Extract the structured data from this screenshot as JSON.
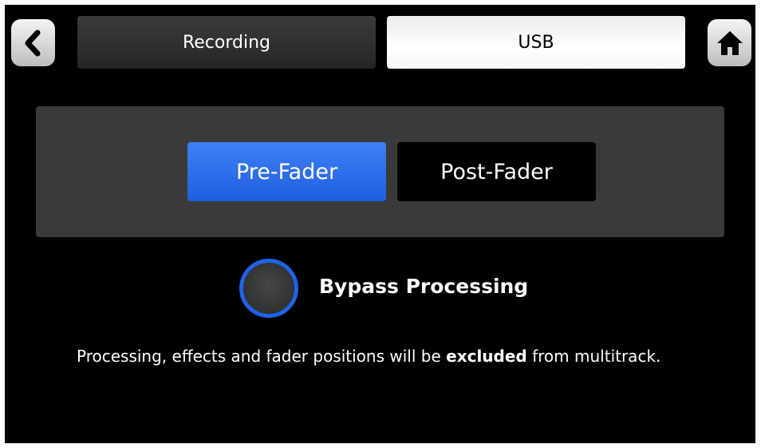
{
  "header": {
    "back_icon": "chevron-left-icon",
    "home_icon": "home-icon",
    "tabs": [
      {
        "label": "Recording",
        "selected": false
      },
      {
        "label": "USB",
        "selected": true
      }
    ]
  },
  "tap_point": {
    "options": [
      "Pre-Fader",
      "Post-Fader"
    ],
    "selected": "Pre-Fader"
  },
  "bypass": {
    "label": "Bypass Processing",
    "enabled": false
  },
  "info": {
    "prefix": "Processing, effects and fader positions will be ",
    "emphasis": "excluded",
    "suffix": " from multitrack."
  },
  "colors": {
    "accent": "#1f5fe0",
    "panel": "#3a3a3a",
    "background": "#000000"
  }
}
